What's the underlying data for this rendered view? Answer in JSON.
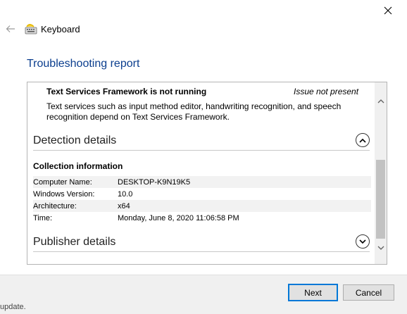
{
  "window": {
    "app_title": "Keyboard",
    "page_title": "Troubleshooting report"
  },
  "icons": {
    "close": "close-icon",
    "back": "back-arrow-icon",
    "app": "keyboard-icon",
    "collapse": "chevron-up-icon",
    "expand": "chevron-down-icon"
  },
  "issue": {
    "title": "Text Services Framework is not running",
    "status": "Issue not present",
    "description": "Text services such as input method editor, handwriting recognition, and speech recognition depend on Text Services Framework."
  },
  "detection": {
    "header": "Detection details",
    "collection_title": "Collection information",
    "rows": [
      {
        "key": "Computer Name:",
        "value": "DESKTOP-K9N19K5"
      },
      {
        "key": "Windows Version:",
        "value": "10.0"
      },
      {
        "key": "Architecture:",
        "value": "x64"
      },
      {
        "key": "Time:",
        "value": "Monday, June 8, 2020 11:06:58 PM"
      }
    ]
  },
  "publisher": {
    "header": "Publisher details"
  },
  "buttons": {
    "next": "Next",
    "cancel": "Cancel"
  },
  "behind": {
    "text": "update."
  },
  "colors": {
    "title_blue": "#0b3e8e",
    "focus_blue": "#0078d7"
  }
}
